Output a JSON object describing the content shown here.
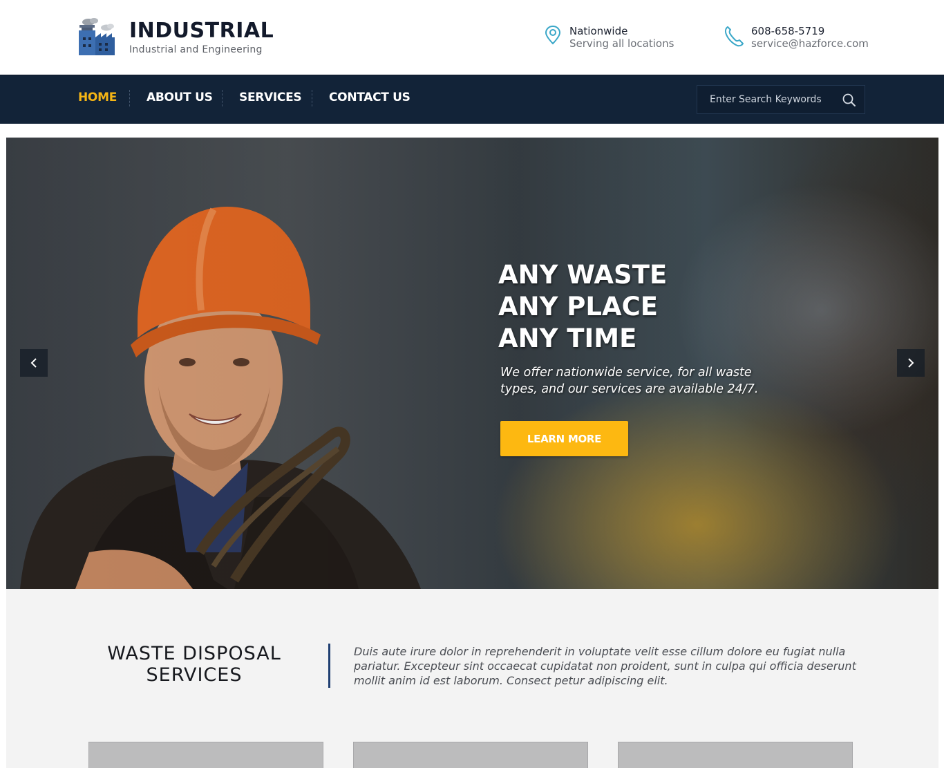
{
  "brand": {
    "title": "INDUSTRIAL",
    "subtitle": "Industrial and Engineering"
  },
  "contacts": [
    {
      "icon": "location-pin-icon",
      "line1": "Nationwide",
      "line2": "Serving all locations"
    },
    {
      "icon": "phone-icon",
      "line1": "608-658-5719",
      "line2": "service@hazforce.com"
    }
  ],
  "nav": {
    "items": [
      {
        "label": "HOME",
        "active": true
      },
      {
        "label": "ABOUT US",
        "active": false
      },
      {
        "label": "SERVICES",
        "active": false
      },
      {
        "label": "CONTACT US",
        "active": false
      }
    ],
    "search_placeholder": "Enter Search Keywords"
  },
  "hero": {
    "title_lines": [
      "ANY WASTE",
      "ANY PLACE",
      "ANY TIME"
    ],
    "description": "We offer nationwide service, for all waste types, and our services are available 24/7.",
    "button_label": "LEARN MORE"
  },
  "services": {
    "title": "WASTE DISPOSAL SERVICES",
    "text": "Duis aute irure dolor in reprehenderit in voluptate velit esse cillum dolore eu fugiat nulla pariatur. Excepteur sint occaecat cupidatat non proident, sunt in culpa qui officia deserunt mollit anim id est laborum. Consect petur adipiscing elit."
  },
  "colors": {
    "nav_bg": "#122338",
    "accent": "#fdb811",
    "active_nav": "#f5b515",
    "icon_teal": "#3aa7c8"
  }
}
